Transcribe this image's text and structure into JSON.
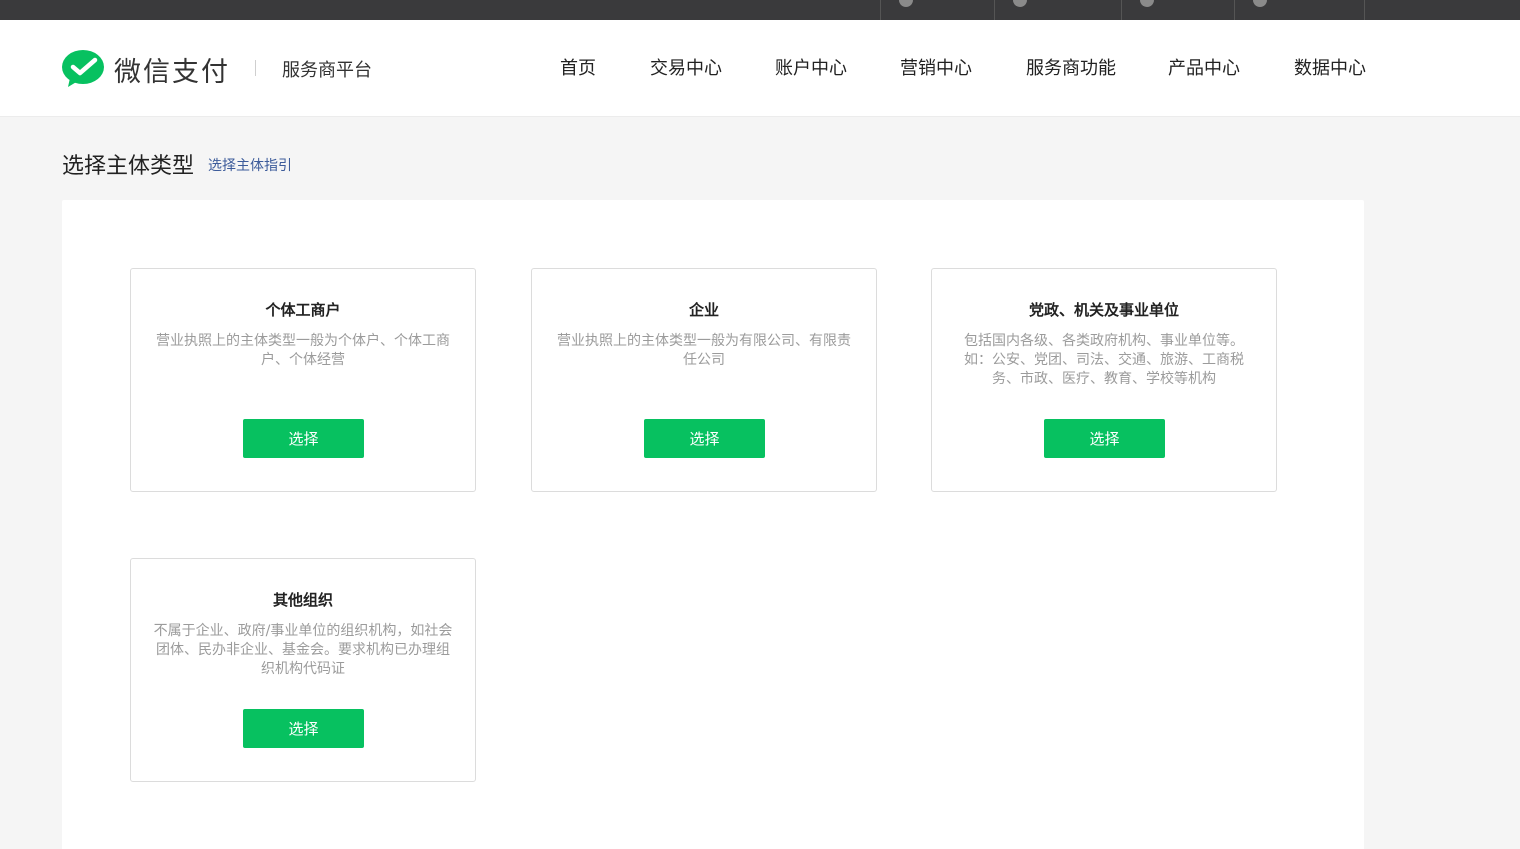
{
  "header": {
    "brand": "微信支付",
    "platform": "服务商平台",
    "nav": [
      "首页",
      "交易中心",
      "账户中心",
      "营销中心",
      "服务商功能",
      "产品中心",
      "数据中心"
    ]
  },
  "page": {
    "title": "选择主体类型",
    "guide_link": "选择主体指引"
  },
  "cards": [
    {
      "title": "个体工商户",
      "desc": "营业执照上的主体类型一般为个体户、个体工商户、个体经营",
      "button": "选择"
    },
    {
      "title": "企业",
      "desc": "营业执照上的主体类型一般为有限公司、有限责任公司",
      "button": "选择"
    },
    {
      "title": "党政、机关及事业单位",
      "desc": "包括国内各级、各类政府机构、事业单位等。如：公安、党团、司法、交通、旅游、工商税务、市政、医疗、教育、学校等机构",
      "button": "选择"
    },
    {
      "title": "其他组织",
      "desc": "不属于企业、政府/事业单位的组织机构，如社会团体、民办非企业、基金会。要求机构已办理组织机构代码证",
      "button": "选择"
    }
  ],
  "colors": {
    "accent": "#07c160",
    "topbar": "#3a3a3c",
    "link": "#3c5b9a"
  },
  "icons": {
    "logo": "wechat-pay-logo-icon"
  }
}
